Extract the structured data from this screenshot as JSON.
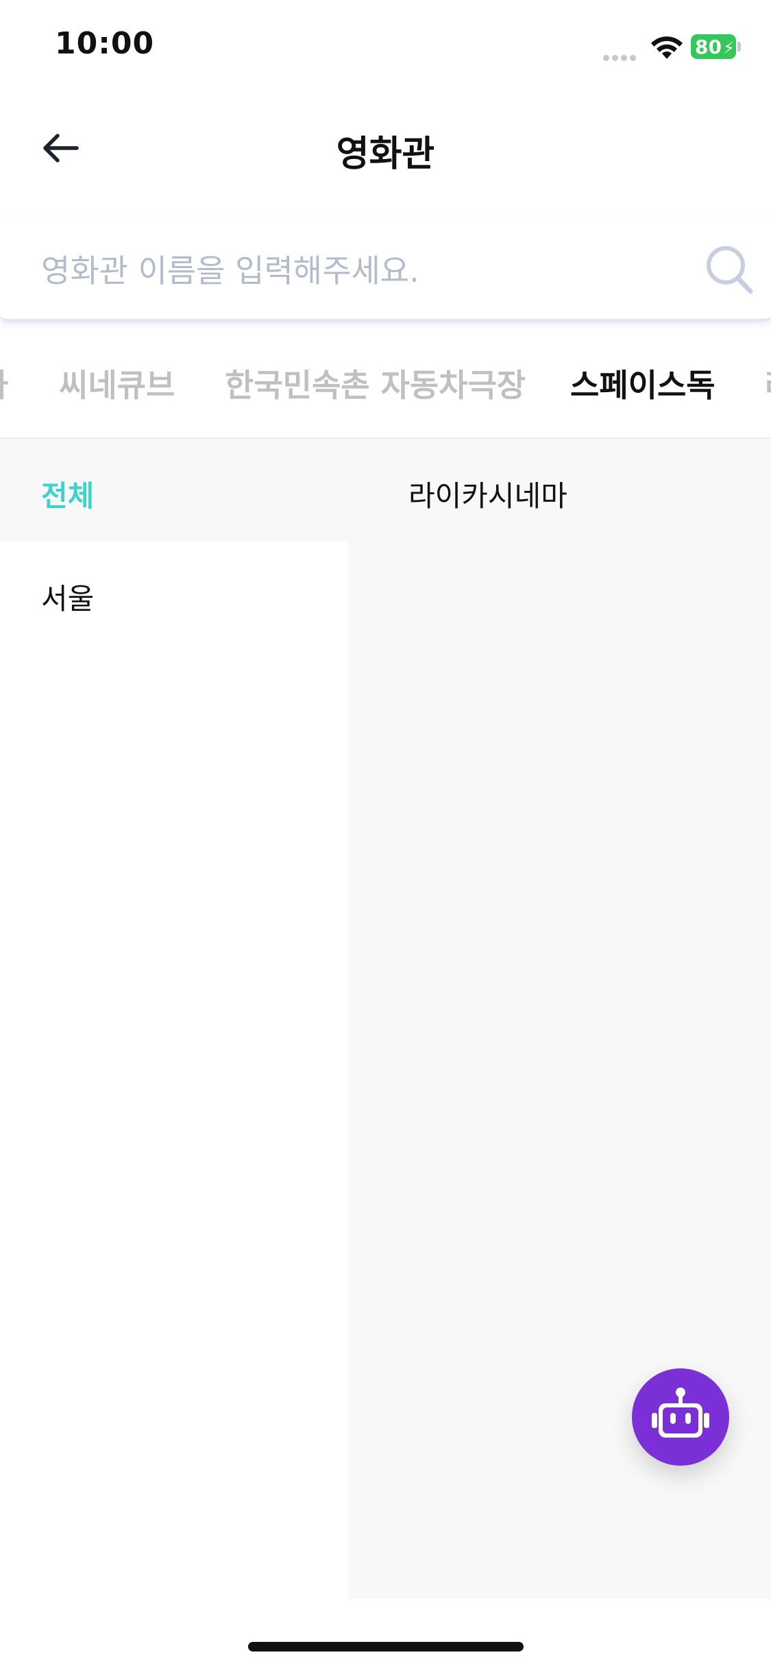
{
  "status_bar": {
    "time": "10:00",
    "battery": "80"
  },
  "header": {
    "title": "영화관"
  },
  "search": {
    "placeholder": "영화관 이름을 입력해주세요.",
    "value": ""
  },
  "tabs": [
    {
      "label": "카"
    },
    {
      "label": "씨네큐브"
    },
    {
      "label": "한국민속촌 자동차극장"
    },
    {
      "label": "스페이스독"
    },
    {
      "label": "라"
    }
  ],
  "active_tab": "스페이스독",
  "regions": [
    {
      "label": "전체",
      "selected": true
    },
    {
      "label": "서울",
      "selected": false
    }
  ],
  "theaters": [
    {
      "label": "라이카시네마"
    }
  ],
  "colors": {
    "accent": "#3ed3c8",
    "fab": "#7b2fd6",
    "battery": "#34c759"
  },
  "icons": {
    "back": "arrow-left-icon",
    "search": "search-icon",
    "fab": "robot-icon"
  }
}
